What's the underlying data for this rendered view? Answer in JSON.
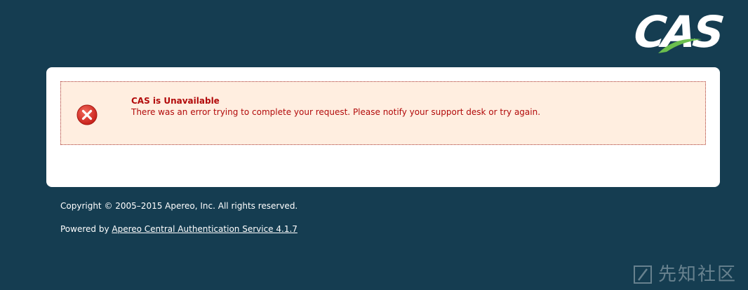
{
  "logo": {
    "text": "CAS"
  },
  "error": {
    "title": "CAS is Unavailable",
    "message": "There was an error trying to complete your request. Please notify your support desk or try again.",
    "icon": "error-x-icon"
  },
  "footer": {
    "copyright": "Copyright © 2005–2015 Apereo, Inc. All rights reserved.",
    "powered_prefix": "Powered by ",
    "powered_link": "Apereo Central Authentication Service 4.1.7"
  },
  "watermark": {
    "text": "先知社区"
  },
  "colors": {
    "background": "#153d51",
    "error_text": "#b20a0a",
    "error_bg": "#ffeee0",
    "swoosh": "#6bbf4e"
  }
}
